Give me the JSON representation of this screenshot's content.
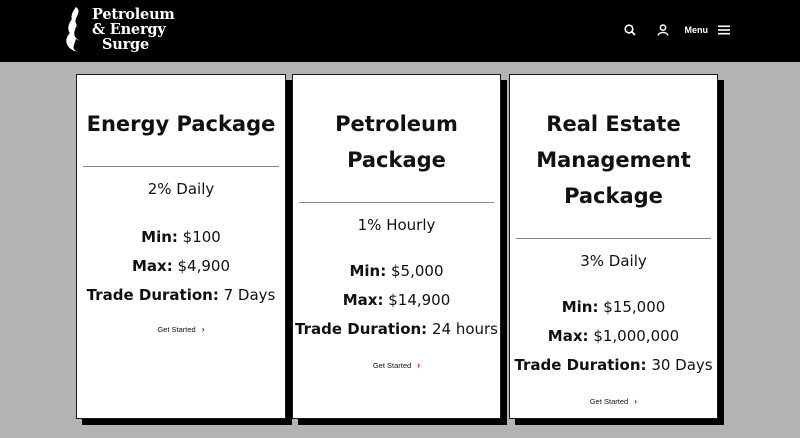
{
  "header": {
    "logo": {
      "line1": "Petroleum",
      "line2": "& Energy",
      "line3": "Surge"
    },
    "nav": {
      "search_icon": "search-icon",
      "user_icon": "user-icon",
      "menu_label": "Menu",
      "menu_icon": "hamburger-icon"
    }
  },
  "cards": [
    {
      "title_lines": [
        "Energy Package"
      ],
      "rate": "2% Daily",
      "min_label": "Min:",
      "min_value": "$100",
      "max_label": "Max:",
      "max_value": "$4,900",
      "duration_label": "Trade Duration:",
      "duration_value": "7 Days",
      "cta": "Get Started"
    },
    {
      "title_lines": [
        "Petroleum",
        "Package"
      ],
      "rate": "1% Hourly",
      "min_label": "Min:",
      "min_value": "$5,000",
      "max_label": "Max:",
      "max_value": "$14,900",
      "duration_label": "Trade Duration:",
      "duration_value": "24 hours",
      "cta": "Get Started"
    },
    {
      "title_lines": [
        "Real Estate",
        "Management",
        "Package"
      ],
      "rate": "3% Daily",
      "min_label": "Min:",
      "min_value": "$15,000",
      "max_label": "Max:",
      "max_value": "$1,000,000",
      "duration_label": "Trade Duration:",
      "duration_value": "30 Days",
      "cta": "Get Started"
    }
  ],
  "colors": {
    "header_bg": "#000000",
    "page_bg": "#b3b3b3",
    "card_bg": "#ffffff",
    "accent": "#c8102e"
  }
}
